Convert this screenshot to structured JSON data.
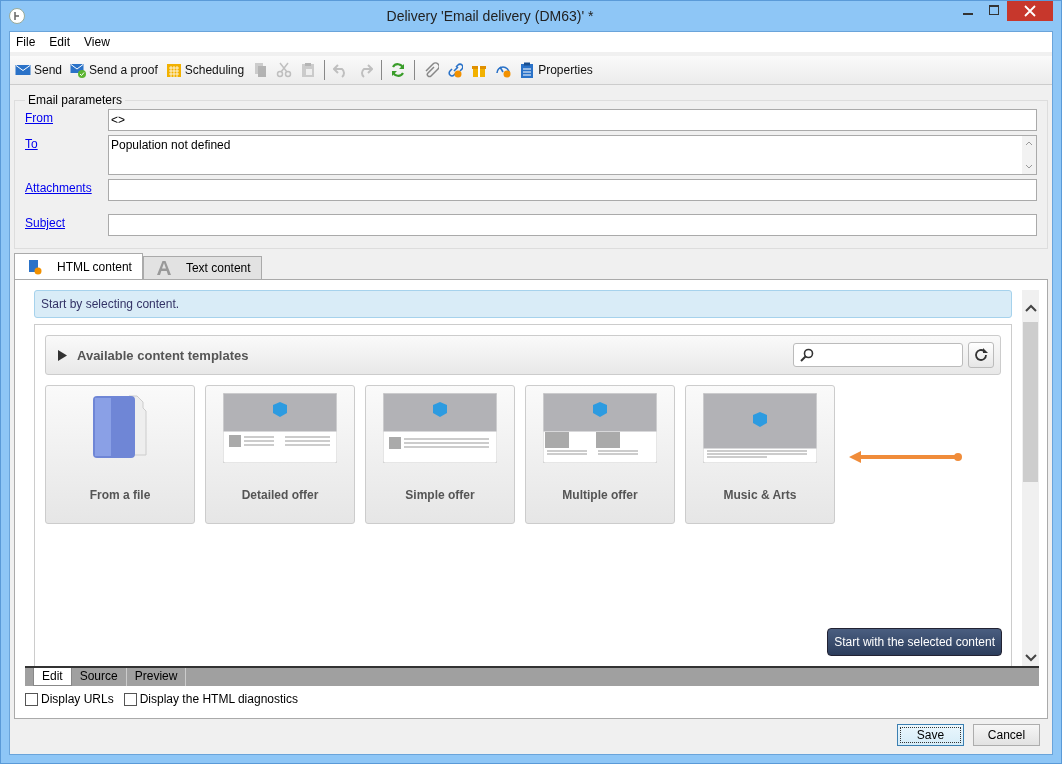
{
  "window": {
    "title": "Delivery 'Email delivery (DM63)' *"
  },
  "menu": [
    "File",
    "Edit",
    "View"
  ],
  "toolbar": [
    [
      {
        "label": "Send",
        "disabled": false
      },
      {
        "label": "Send a proof",
        "disabled": false
      },
      {
        "label": "Scheduling",
        "disabled": false
      },
      {
        "disabled": true
      },
      {
        "disabled": true
      },
      {
        "disabled": true
      }
    ],
    [
      {
        "disabled": true
      },
      {
        "disabled": true
      }
    ],
    [
      {
        "disabled": false
      }
    ],
    [
      {
        "disabled": false
      },
      {
        "disabled": false
      },
      {
        "disabled": false
      },
      {
        "disabled": false
      },
      {
        "label": "Properties",
        "disabled": false
      }
    ]
  ],
  "email_parameters": {
    "legend": "Email parameters",
    "fields": [
      {
        "label": "From",
        "value": "<>",
        "kind": "line"
      },
      {
        "label": "To",
        "value": "Population not defined",
        "kind": "multiline"
      },
      {
        "label": "Attachments",
        "kind": "line"
      },
      {
        "label": "Subject",
        "kind": "line"
      }
    ]
  },
  "tabs": [
    {
      "label": "HTML content",
      "selected": true
    },
    {
      "label": "Text content",
      "selected": false
    }
  ],
  "info": "Start by selecting content.",
  "templates": {
    "title": "Available content templates",
    "items": [
      {
        "label": "From a file",
        "kind": "file"
      },
      {
        "label": "Detailed offer",
        "kind": "detailed"
      },
      {
        "label": "Simple offer",
        "kind": "simple"
      },
      {
        "label": "Multiple offer",
        "kind": "multiple"
      },
      {
        "label": "Music & Arts",
        "kind": "music"
      }
    ]
  },
  "start_button": "Start with the selected content",
  "editor_tabs": [
    {
      "label": "Edit",
      "selected": true
    },
    {
      "label": "Source",
      "selected": false
    },
    {
      "label": "Preview",
      "selected": false
    }
  ],
  "options": [
    {
      "label": "Display URLs",
      "checked": false
    },
    {
      "label": "Display the HTML diagnostics",
      "checked": false
    }
  ],
  "buttons": [
    {
      "label": "Save",
      "default": true
    },
    {
      "label": "Cancel",
      "default": false
    }
  ]
}
